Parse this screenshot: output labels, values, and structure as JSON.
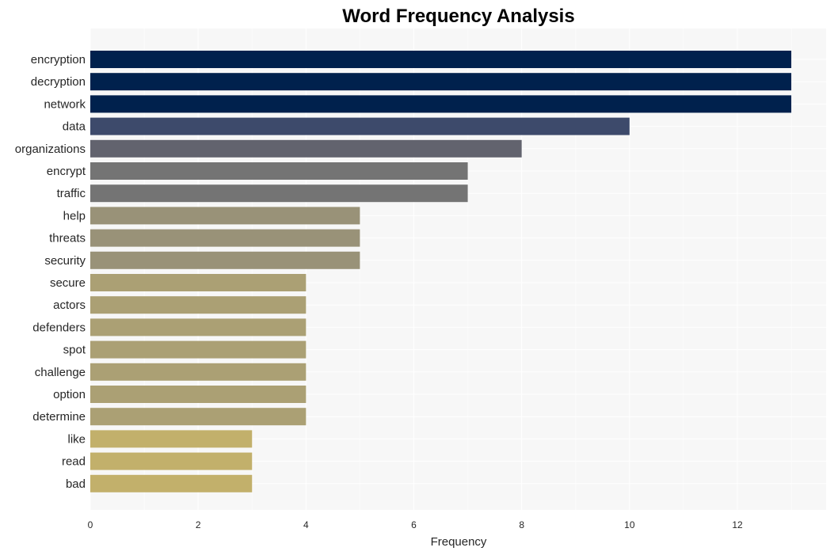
{
  "chart_data": {
    "type": "bar",
    "orientation": "horizontal",
    "title": "Word Frequency Analysis",
    "xlabel": "Frequency",
    "ylabel": "",
    "xlim": [
      0,
      13.6
    ],
    "xticks": [
      0,
      2,
      4,
      6,
      8,
      10,
      12
    ],
    "grid": true,
    "legend": "none",
    "categories": [
      "encryption",
      "decryption",
      "network",
      "data",
      "organizations",
      "encrypt",
      "traffic",
      "help",
      "threats",
      "security",
      "secure",
      "actors",
      "defenders",
      "spot",
      "challenge",
      "option",
      "determine",
      "like",
      "read",
      "bad"
    ],
    "values": [
      13,
      13,
      13,
      10,
      8,
      7,
      7,
      5,
      5,
      5,
      4,
      4,
      4,
      4,
      4,
      4,
      4,
      3,
      3,
      3
    ],
    "colors": [
      "#00214d",
      "#00214d",
      "#00214d",
      "#3d4a6b",
      "#62636e",
      "#747474",
      "#747474",
      "#999278",
      "#999278",
      "#999278",
      "#aba074",
      "#aba074",
      "#aba074",
      "#aba074",
      "#aba074",
      "#aba074",
      "#aba074",
      "#c2b06b",
      "#c2b06b",
      "#c2b06b"
    ]
  }
}
